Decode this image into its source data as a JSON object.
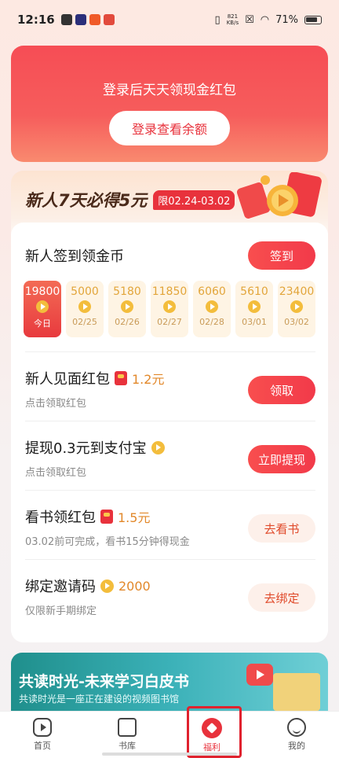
{
  "status": {
    "time": "12:16",
    "speed_top": "821",
    "speed_bottom": "KB/s",
    "battery": "71%"
  },
  "login": {
    "title": "登录后天天领现金红包",
    "button": "登录查看余额"
  },
  "newuser": {
    "title": "新人7天必得5元",
    "tag": "限02.24-03.02",
    "signin": {
      "title": "新人签到领金币",
      "button": "签到"
    },
    "days": [
      {
        "coins": "19800",
        "date": "今日",
        "today": true
      },
      {
        "coins": "5000",
        "date": "02/25"
      },
      {
        "coins": "5180",
        "date": "02/26"
      },
      {
        "coins": "11850",
        "date": "02/27"
      },
      {
        "coins": "6060",
        "date": "02/28"
      },
      {
        "coins": "5610",
        "date": "03/01"
      },
      {
        "coins": "23400",
        "date": "03/02"
      }
    ],
    "tasks": [
      {
        "title": "新人见面红包",
        "amount": "1.2元",
        "sub": "点击领取红包",
        "button": "领取"
      },
      {
        "title": "提现0.3元到支付宝",
        "amount": "",
        "sub": "点击领取红包",
        "button": "立即提现"
      },
      {
        "title": "看书领红包",
        "amount": "1.5元",
        "sub": "03.02前可完成，看书15分钟得现金",
        "button": "去看书"
      },
      {
        "title": "绑定邀请码",
        "amount": "2000",
        "sub": "仅限新手期绑定",
        "button": "去绑定"
      }
    ]
  },
  "promo": {
    "title": "共读时光-未来学习白皮书",
    "sub": "共读时光是一座正在建设的视频图书馆"
  },
  "tabs": [
    {
      "label": "首页",
      "icon": "play-icon"
    },
    {
      "label": "书库",
      "icon": "library-icon"
    },
    {
      "label": "福利",
      "icon": "welfare-icon"
    },
    {
      "label": "我的",
      "icon": "profile-icon"
    }
  ],
  "colors": {
    "accent": "#e8323c",
    "coin": "#f3bd3c"
  }
}
